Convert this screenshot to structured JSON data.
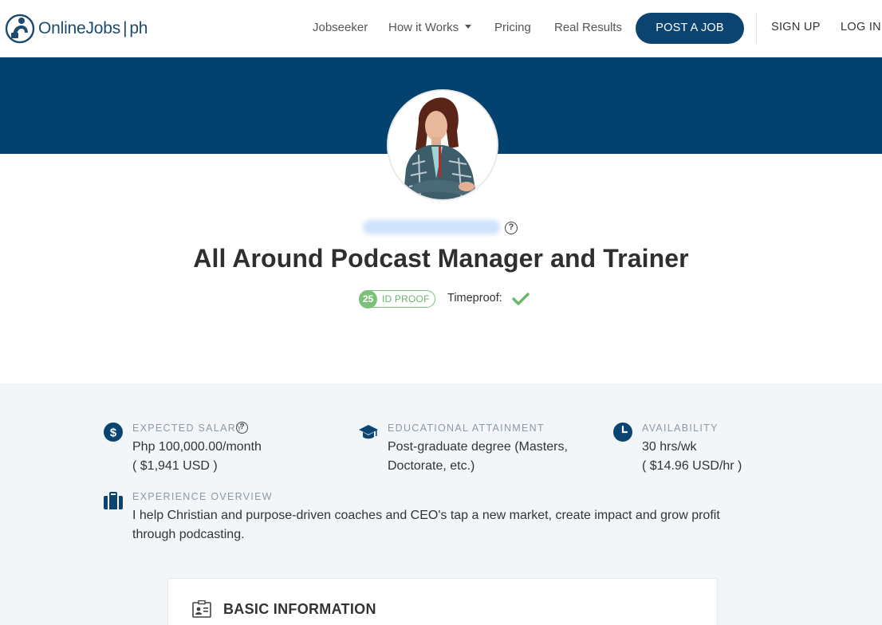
{
  "nav": {
    "logo_left": "OnlineJobs",
    "logo_right": "ph",
    "links": [
      "Jobseeker",
      "How it Works",
      "Pricing",
      "Real Results"
    ],
    "post_job": "POST A JOB",
    "sign_up": "SIGN UP",
    "log_in": "LOG IN"
  },
  "profile": {
    "title": "All Around Podcast Manager and Trainer",
    "id_proof_score": "25",
    "id_proof_label": "ID PROOF",
    "timeproof_label": "Timeproof:",
    "help_glyph": "?"
  },
  "details": {
    "salary": {
      "label": "EXPECTED SALARY",
      "line1": "Php 100,000.00/month",
      "line2": "( $1,941 USD )"
    },
    "education": {
      "label": "EDUCATIONAL ATTAINMENT",
      "line1": "Post-graduate degree (Masters,",
      "line2": "Doctorate, etc.)"
    },
    "availability": {
      "label": "AVAILABILITY",
      "line1": "30 hrs/wk",
      "line2": "( $14.96 USD/hr )"
    },
    "experience": {
      "label": "EXPERIENCE OVERVIEW",
      "line1": "I help Christian and purpose-driven coaches and CEO's tap a new market, create impact and grow profit",
      "line2": "through podcasting."
    }
  },
  "card": {
    "title": "BASIC INFORMATION"
  },
  "colors": {
    "brand": "#03426f",
    "button": "#0c4471",
    "proof_green": "#7cc17a",
    "label_grey": "#8a9aa8",
    "section_bg": "#f3f6f9"
  },
  "icons": {
    "logo": "figure-logo-icon",
    "salary": "dollar-icon",
    "education": "graduation-cap-icon",
    "availability": "clock-icon",
    "experience": "briefcase-icon",
    "card": "id-card-icon",
    "help": "question-circle-icon",
    "timeproof": "check-icon"
  }
}
